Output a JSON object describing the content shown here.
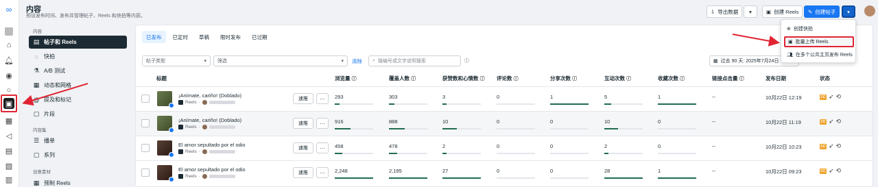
{
  "header": {
    "title": "内容",
    "subtitle": "预设发布时间、发布并管理帖子、Reels 和快拍等内容。",
    "export_label": "导出数据",
    "create_reels_label": "创建 Reels",
    "create_post_label": "创建帖子"
  },
  "sidebar": {
    "section_content": "内容",
    "section_collections": "内容集",
    "section_creative": "创意素材",
    "items": [
      {
        "label": "帖子和 Reels",
        "icon": "posts-icon"
      },
      {
        "label": "快拍",
        "icon": "stories-icon"
      },
      {
        "label": "A/B 测试",
        "icon": "ab-test-icon"
      },
      {
        "label": "动态和网格",
        "icon": "grid-icon"
      },
      {
        "label": "提及和标记",
        "icon": "mentions-icon"
      },
      {
        "label": "片段",
        "icon": "clips-icon"
      },
      {
        "label": "播单",
        "icon": "playlist-icon"
      },
      {
        "label": "系列",
        "icon": "series-icon"
      },
      {
        "label": "预制 Reels",
        "icon": "template-icon"
      }
    ]
  },
  "tabs": [
    "已发布",
    "已定时",
    "草稿",
    "限时发布",
    "已过期"
  ],
  "filters": {
    "post_type_placeholder": "帖子类型",
    "filter_placeholder": "筛选",
    "clear_label": "清除",
    "search_placeholder": "搜编号或文字说明搜索",
    "date_range": "过去 90 天: 2025年7月24日"
  },
  "table": {
    "columns": [
      "标题",
      "浏览量",
      "覆盖人数",
      "获赞数和心情数",
      "评论数",
      "分享次数",
      "互动次数",
      "收藏次数",
      "链接点击量",
      "发布日期",
      "状态"
    ],
    "boost_label": "速推",
    "more_label": "···",
    "rows": [
      {
        "title": "¡Anímate, cariño! (Doblado)",
        "type": "Reels",
        "views": "293",
        "reach": "303",
        "reactions": "3",
        "comments": "0",
        "shares": "1",
        "engagement": "5",
        "saves": "1",
        "link_clicks": "--",
        "date": "10月22日 12:19"
      },
      {
        "title": "¡Anímate, cariño! (Doblado)",
        "type": "Reels",
        "views": "916",
        "reach": "888",
        "reactions": "10",
        "comments": "0",
        "shares": "0",
        "engagement": "10",
        "saves": "0",
        "link_clicks": "--",
        "date": "10月22日 11:19"
      },
      {
        "title": "El amor sepultado por el odio",
        "type": "Reels",
        "views": "458",
        "reach": "478",
        "reactions": "2",
        "comments": "0",
        "shares": "0",
        "engagement": "2",
        "saves": "0",
        "link_clicks": "--",
        "date": "10月22日 10:23"
      },
      {
        "title": "El amor sepultado por el odio",
        "type": "Reels",
        "views": "2,248",
        "reach": "2,195",
        "reactions": "27",
        "comments": "0",
        "shares": "0",
        "engagement": "28",
        "saves": "1",
        "link_clicks": "--",
        "date": "10月22日 09:23"
      }
    ]
  },
  "menu": {
    "items": [
      "创建快拍",
      "批量上传 Reels",
      "在多个公共主页发布 Reels"
    ]
  },
  "colors": {
    "accent": "#1877f2",
    "highlight": "#e02432",
    "bar": "#1f6b4f"
  }
}
